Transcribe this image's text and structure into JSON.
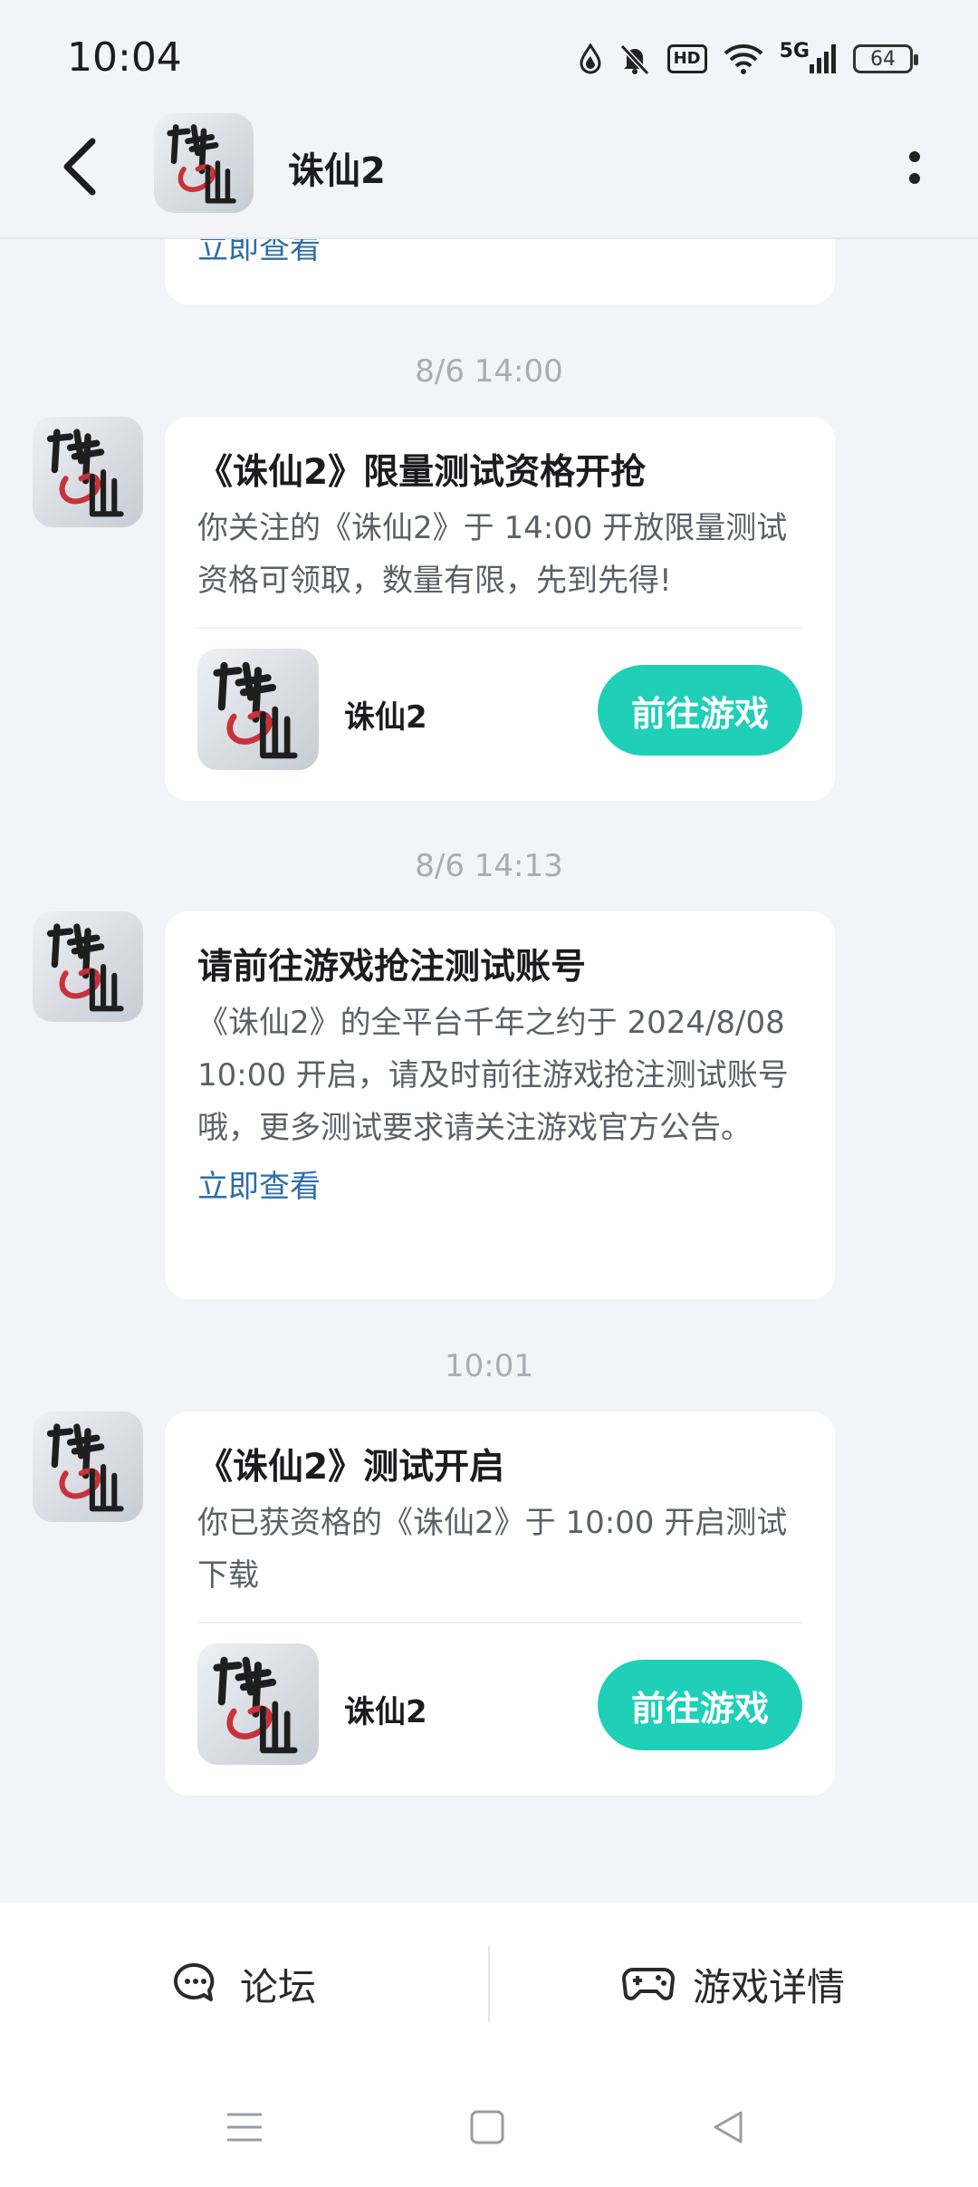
{
  "status_bar": {
    "time": "10:04",
    "icons": [
      "drop-icon",
      "bell-off-icon",
      "hd-icon",
      "wifi-icon",
      "signal-5g-icon",
      "battery-icon"
    ],
    "hd_label": "HD",
    "network_label": "5G",
    "battery_level": "64"
  },
  "header": {
    "title": "诛仙2"
  },
  "feed": {
    "top_partial_link": "立即查看",
    "messages": [
      {
        "time": "8/6  14:00",
        "title": "《诛仙2》限量测试资格开抢",
        "body": "你关注的《诛仙2》于 14:00 开放限量测试资格可领取，数量有限，先到先得!",
        "game_name": "诛仙2",
        "action": "前往游戏"
      },
      {
        "time": "8/6  14:13",
        "title": "请前往游戏抢注测试账号",
        "body": "《诛仙2》的全平台千年之约于 2024/8/08 10:00 开启，请及时前往游戏抢注测试账号哦，更多测试要求请关注游戏官方公告。",
        "link": "立即查看"
      },
      {
        "time": "10:01",
        "title": "《诛仙2》测试开启",
        "body": "你已获资格的《诛仙2》于 10:00 开启测试下载",
        "game_name": "诛仙2",
        "action": "前往游戏"
      }
    ]
  },
  "bottom_bar": {
    "forum_label": "论坛",
    "details_label": "游戏详情"
  },
  "colors": {
    "accent": "#1fcfb8",
    "link": "#2d6ea7",
    "background": "#f3f4f7"
  }
}
